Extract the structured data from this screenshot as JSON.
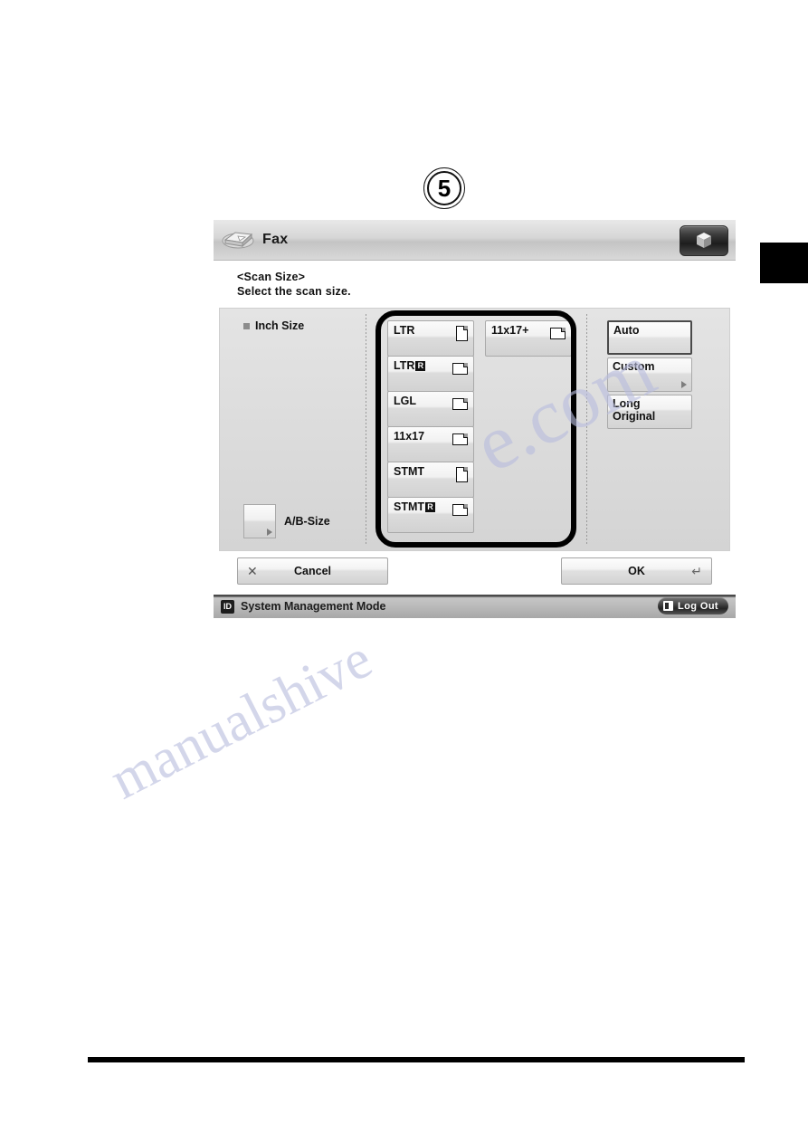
{
  "step": {
    "number": "5"
  },
  "screen": {
    "title_bar": {
      "title": "Fax",
      "fax_icon": "fax-machine-icon",
      "cube_button_icon": "3d-cube-icon"
    },
    "instruction": {
      "heading": "<Scan Size>",
      "prompt": "Select the scan size."
    },
    "panel": {
      "group_label": "Inch Size",
      "ab_size_button": "A/B-Size",
      "size_buttons": [
        {
          "label": "LTR",
          "orientation": "portrait",
          "rotated": false
        },
        {
          "label": "LTR",
          "orientation": "landscape",
          "rotated": true
        },
        {
          "label": "LGL",
          "orientation": "landscape",
          "rotated": false
        },
        {
          "label": "11x17",
          "orientation": "landscape",
          "rotated": false
        },
        {
          "label": "STMT",
          "orientation": "portrait",
          "rotated": false
        },
        {
          "label": "STMT",
          "orientation": "landscape",
          "rotated": true
        },
        {
          "label": "11x17+",
          "orientation": "landscape",
          "rotated": false
        }
      ],
      "rotated_badge": "R",
      "options": [
        {
          "label": "Auto",
          "selected": true,
          "has_arrow": false
        },
        {
          "label": "Custom",
          "selected": false,
          "has_arrow": true
        },
        {
          "label": "Long\nOriginal",
          "selected": false,
          "has_arrow": false
        }
      ]
    },
    "actions": {
      "cancel_label": "Cancel",
      "cancel_icon": "close-x-icon",
      "ok_label": "OK",
      "ok_icon": "enter-arrow-icon"
    },
    "status_bar": {
      "id_badge": "ID",
      "mode_text": "System Management Mode",
      "logout_label": "Log Out",
      "logout_icon": "logout-door-icon"
    }
  },
  "watermark": {
    "text1": "e.com",
    "text2": "manualshive"
  },
  "colors": {
    "panel_bg": "#dcdcdc",
    "title_bar": "#d6d6d6",
    "highlight": "#000000",
    "status_bar": "#b8b8b8"
  }
}
